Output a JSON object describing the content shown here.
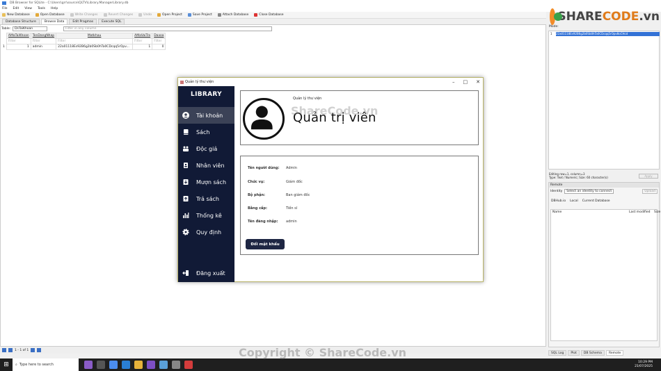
{
  "db_window": {
    "title": "DB Browser for SQLite - C:\\Users\\grr\\source\\QLTV\\Library.ManagerLibrary.db",
    "menu": [
      "File",
      "Edit",
      "View",
      "Tools",
      "Help"
    ],
    "toolbar": [
      "New Database",
      "Open Database",
      "Write Changes",
      "Revert Changes",
      "Undo",
      "Open Project",
      "Save Project",
      "Attach Database",
      "Close Database"
    ],
    "tabs": [
      "Database Structure",
      "Browse Data",
      "Edit Pragmas",
      "Execute SQL"
    ],
    "table_label": "Table:",
    "table_name": "DsTaiKhoan",
    "filter_all": "Filter in any column",
    "columns": [
      "AMaTaiKhoan",
      "TenDangNhap",
      "Matkhau",
      "AMaVaiTro",
      "Daxoa"
    ],
    "filter_placeholder": "Filter",
    "rows": [
      {
        "num": "1",
        "cells": [
          "1",
          "admin",
          "22a01118Es92B6g2b0Sb0hTa0CDcqq5rOpv...",
          "1",
          "0"
        ]
      }
    ],
    "status_page": "1 - 1 of 1",
    "edit_cell_value": "22a01118Es92B6g2b0Sb0hTa0CDcqq5rOpv8oCHcd",
    "edit_cell_info": "Editing row=1, column=3",
    "edit_cell_type": "Type: Text / Numeric; Size: 60 character(s)",
    "edit_cell_mode": "Mode:",
    "apply_label": "Apply",
    "remote": {
      "title": "Remote",
      "identity_label": "Identity",
      "identity_value": "Select an identity to connect",
      "upload": "Upload",
      "tabs": [
        "DBHub.io",
        "Local",
        "Current Database"
      ],
      "columns": [
        "Name",
        "Last modified",
        "Size"
      ]
    },
    "bottom_tabs": [
      "SQL Log",
      "Plot",
      "DB Schema",
      "Remote"
    ]
  },
  "library_app": {
    "window_title": "Quản lý thư viện",
    "brand": "LIBRARY",
    "menu": [
      {
        "label": "Tài khoản",
        "icon": "user-circle-icon",
        "active": true
      },
      {
        "label": "Sách",
        "icon": "book-icon",
        "active": false
      },
      {
        "label": "Độc giả",
        "icon": "readers-icon",
        "active": false
      },
      {
        "label": "Nhân viên",
        "icon": "id-card-icon",
        "active": false
      },
      {
        "label": "Mượn sách",
        "icon": "download-icon",
        "active": false
      },
      {
        "label": "Trả sách",
        "icon": "upload-icon",
        "active": false
      },
      {
        "label": "Thống kê",
        "icon": "bar-chart-icon",
        "active": false
      },
      {
        "label": "Quy định",
        "icon": "gear-icon",
        "active": false
      }
    ],
    "logout": "Đăng xuất",
    "profile": {
      "subtitle": "Quản lý thư viện",
      "role_title": "Quản trị viên"
    },
    "info": [
      {
        "label": "Tên người dùng:",
        "value": "Admin"
      },
      {
        "label": "Chức vụ:",
        "value": "Giám đốc"
      },
      {
        "label": "Bộ phận:",
        "value": "Ban giám đốc"
      },
      {
        "label": "Bằng cấp:",
        "value": "Tiến sĩ"
      },
      {
        "label": "Tên đăng nhập:",
        "value": "admin"
      }
    ],
    "change_password": "Đổi mật khẩu"
  },
  "watermarks": {
    "logo_text_a": "SHARE",
    "logo_text_b": "CODE",
    "logo_text_c": ".vn",
    "center": "ShareCode.vn",
    "bottom": "Copyright © ShareCode.vn"
  },
  "taskbar": {
    "search_placeholder": "Type here to search",
    "time": "10:29 PM",
    "date": "21/07/2025"
  },
  "colors": {
    "sidebar_bg": "#111a36",
    "sidebar_active": "#3b4257",
    "button_bg": "#1e2643",
    "selection": "#3372d6"
  }
}
